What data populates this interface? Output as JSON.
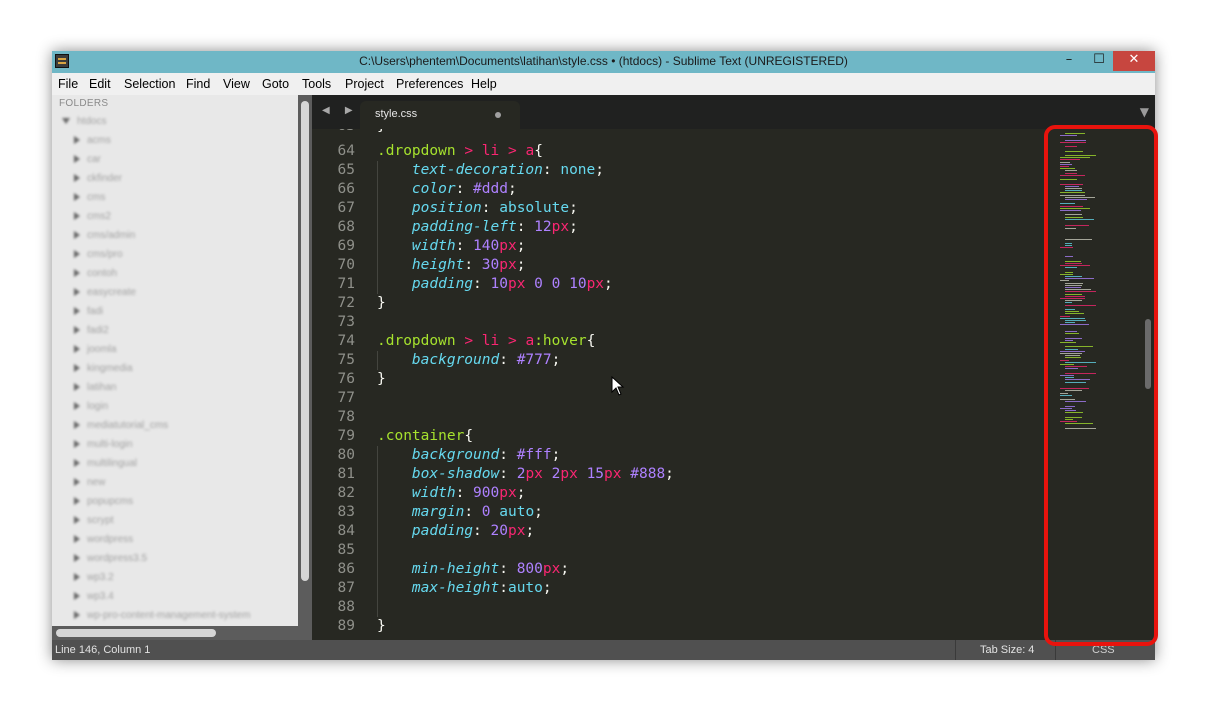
{
  "window": {
    "title": "C:\\Users\\phentem\\Documents\\latihan\\style.css • (htdocs) - Sublime Text (UNREGISTERED)",
    "controls": {
      "minimize": "–",
      "maximize": "☐",
      "close": "✕"
    }
  },
  "menu": [
    "File",
    "Edit",
    "Selection",
    "Find",
    "View",
    "Goto",
    "Tools",
    "Project",
    "Preferences",
    "Help"
  ],
  "sidebar": {
    "header": "FOLDERS",
    "root": "htdocs",
    "items": [
      "acms",
      "car",
      "ckfinder",
      "cms",
      "cms2",
      "cms/admin",
      "cms/pro",
      "contoh",
      "easycreate",
      "fadi",
      "fadi2",
      "joomla",
      "kingmedia",
      "latihan",
      "login",
      "mediatutorial_cms",
      "multi-login",
      "multilingual",
      "new",
      "popupcms",
      "scrypt",
      "wordpress",
      "wordpress3.5",
      "wp3.2",
      "wp3.4",
      "wp-pro-content-management-system"
    ]
  },
  "tabs": {
    "nav_arrows": "◀ ▶",
    "active_label": "style.css",
    "dropdown": "▼"
  },
  "code": {
    "first_partial_line": "63",
    "first_partial_text": "}",
    "lines": [
      {
        "n": "64",
        "t": [
          [
            "sel",
            ".dropdown"
          ],
          [
            "pl",
            " "
          ],
          [
            "op",
            ">"
          ],
          [
            "pl",
            " "
          ],
          [
            "un",
            "li"
          ],
          [
            "pl",
            " "
          ],
          [
            "op",
            ">"
          ],
          [
            "pl",
            " "
          ],
          [
            "un",
            "a"
          ],
          [
            "pl",
            "{"
          ]
        ]
      },
      {
        "n": "65",
        "t": [
          [
            "pl",
            "    "
          ],
          [
            "pr",
            "text-decoration"
          ],
          [
            "pl",
            ": "
          ],
          [
            "kw",
            "none"
          ],
          [
            "pl",
            ";"
          ]
        ]
      },
      {
        "n": "66",
        "t": [
          [
            "pl",
            "    "
          ],
          [
            "pr",
            "color"
          ],
          [
            "pl",
            ": "
          ],
          [
            "nm",
            "#ddd"
          ],
          [
            "pl",
            ";"
          ]
        ]
      },
      {
        "n": "67",
        "t": [
          [
            "pl",
            "    "
          ],
          [
            "pr",
            "position"
          ],
          [
            "pl",
            ": "
          ],
          [
            "kw",
            "absolute"
          ],
          [
            "pl",
            ";"
          ]
        ]
      },
      {
        "n": "68",
        "t": [
          [
            "pl",
            "    "
          ],
          [
            "pr",
            "padding-left"
          ],
          [
            "pl",
            ": "
          ],
          [
            "nm",
            "12"
          ],
          [
            "un",
            "px"
          ],
          [
            "pl",
            ";"
          ]
        ]
      },
      {
        "n": "69",
        "t": [
          [
            "pl",
            "    "
          ],
          [
            "pr",
            "width"
          ],
          [
            "pl",
            ": "
          ],
          [
            "nm",
            "140"
          ],
          [
            "un",
            "px"
          ],
          [
            "pl",
            ";"
          ]
        ]
      },
      {
        "n": "70",
        "t": [
          [
            "pl",
            "    "
          ],
          [
            "pr",
            "height"
          ],
          [
            "pl",
            ": "
          ],
          [
            "nm",
            "30"
          ],
          [
            "un",
            "px"
          ],
          [
            "pl",
            ";"
          ]
        ]
      },
      {
        "n": "71",
        "t": [
          [
            "pl",
            "    "
          ],
          [
            "pr",
            "padding"
          ],
          [
            "pl",
            ": "
          ],
          [
            "nm",
            "10"
          ],
          [
            "un",
            "px"
          ],
          [
            "pl",
            " "
          ],
          [
            "nm",
            "0"
          ],
          [
            "pl",
            " "
          ],
          [
            "nm",
            "0"
          ],
          [
            "pl",
            " "
          ],
          [
            "nm",
            "10"
          ],
          [
            "un",
            "px"
          ],
          [
            "pl",
            ";"
          ]
        ]
      },
      {
        "n": "72",
        "t": [
          [
            "pl",
            "}"
          ]
        ]
      },
      {
        "n": "73",
        "t": []
      },
      {
        "n": "74",
        "t": [
          [
            "sel",
            ".dropdown"
          ],
          [
            "pl",
            " "
          ],
          [
            "op",
            ">"
          ],
          [
            "pl",
            " "
          ],
          [
            "un",
            "li"
          ],
          [
            "pl",
            " "
          ],
          [
            "op",
            ">"
          ],
          [
            "pl",
            " "
          ],
          [
            "un",
            "a"
          ],
          [
            "sel",
            ":hover"
          ],
          [
            "pl",
            "{"
          ]
        ]
      },
      {
        "n": "75",
        "t": [
          [
            "pl",
            "    "
          ],
          [
            "pr",
            "background"
          ],
          [
            "pl",
            ": "
          ],
          [
            "nm",
            "#777"
          ],
          [
            "pl",
            ";"
          ]
        ]
      },
      {
        "n": "76",
        "t": [
          [
            "pl",
            "}"
          ]
        ]
      },
      {
        "n": "77",
        "t": []
      },
      {
        "n": "78",
        "t": []
      },
      {
        "n": "79",
        "t": [
          [
            "sel",
            ".container"
          ],
          [
            "pl",
            "{"
          ]
        ]
      },
      {
        "n": "80",
        "t": [
          [
            "pl",
            "    "
          ],
          [
            "pr",
            "background"
          ],
          [
            "pl",
            ": "
          ],
          [
            "nm",
            "#fff"
          ],
          [
            "pl",
            ";"
          ]
        ]
      },
      {
        "n": "81",
        "t": [
          [
            "pl",
            "    "
          ],
          [
            "pr",
            "box-shadow"
          ],
          [
            "pl",
            ": "
          ],
          [
            "nm",
            "2"
          ],
          [
            "un",
            "px"
          ],
          [
            "pl",
            " "
          ],
          [
            "nm",
            "2"
          ],
          [
            "un",
            "px"
          ],
          [
            "pl",
            " "
          ],
          [
            "nm",
            "15"
          ],
          [
            "un",
            "px"
          ],
          [
            "pl",
            " "
          ],
          [
            "nm",
            "#888"
          ],
          [
            "pl",
            ";"
          ]
        ]
      },
      {
        "n": "82",
        "t": [
          [
            "pl",
            "    "
          ],
          [
            "pr",
            "width"
          ],
          [
            "pl",
            ": "
          ],
          [
            "nm",
            "900"
          ],
          [
            "un",
            "px"
          ],
          [
            "pl",
            ";"
          ]
        ]
      },
      {
        "n": "83",
        "t": [
          [
            "pl",
            "    "
          ],
          [
            "pr",
            "margin"
          ],
          [
            "pl",
            ": "
          ],
          [
            "nm",
            "0"
          ],
          [
            "pl",
            " "
          ],
          [
            "kw",
            "auto"
          ],
          [
            "pl",
            ";"
          ]
        ]
      },
      {
        "n": "84",
        "t": [
          [
            "pl",
            "    "
          ],
          [
            "pr",
            "padding"
          ],
          [
            "pl",
            ": "
          ],
          [
            "nm",
            "20"
          ],
          [
            "un",
            "px"
          ],
          [
            "pl",
            ";"
          ]
        ]
      },
      {
        "n": "85",
        "t": []
      },
      {
        "n": "86",
        "t": [
          [
            "pl",
            "    "
          ],
          [
            "pr",
            "min-height"
          ],
          [
            "pl",
            ": "
          ],
          [
            "nm",
            "800"
          ],
          [
            "un",
            "px"
          ],
          [
            "pl",
            ";"
          ]
        ]
      },
      {
        "n": "87",
        "t": [
          [
            "pl",
            "    "
          ],
          [
            "pr",
            "max-height"
          ],
          [
            "pl",
            ":"
          ],
          [
            "kw",
            "auto"
          ],
          [
            "pl",
            ";"
          ]
        ]
      },
      {
        "n": "88",
        "t": []
      },
      {
        "n": "89",
        "t": [
          [
            "pl",
            "}"
          ]
        ]
      }
    ]
  },
  "status": {
    "position": "Line 146, Column 1",
    "tab_size": "Tab Size: 4",
    "syntax": "CSS"
  },
  "colors": {
    "editor_bg": "#272822",
    "selector": "#a6e22e",
    "property": "#66d9ef",
    "number": "#ae81ff",
    "unit": "#f92672",
    "highlight_border": "#e8130d"
  }
}
